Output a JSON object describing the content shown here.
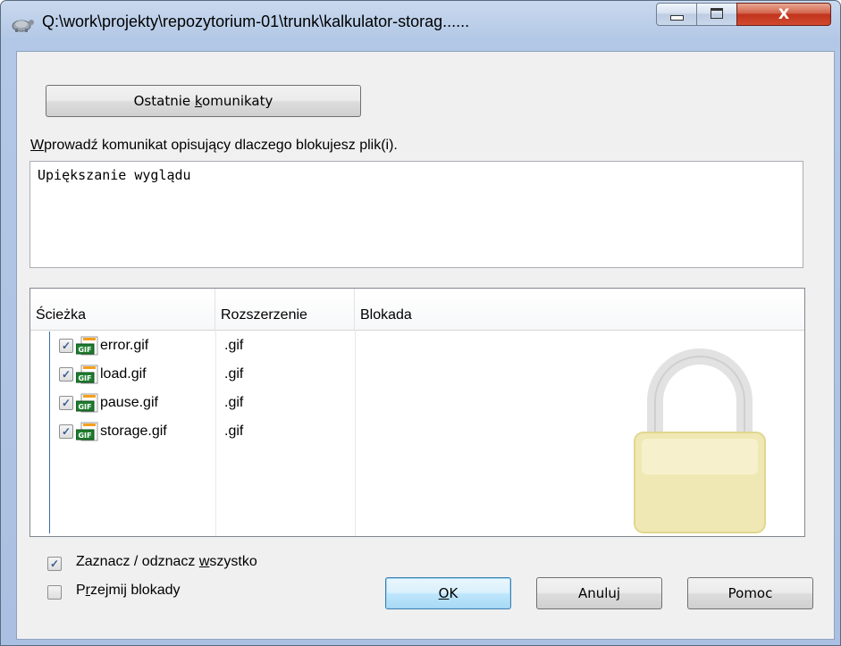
{
  "window": {
    "title": "Q:\\work\\projekty\\repozytorium-01\\trunk\\kalkulator-storag......",
    "close_glyph": "X"
  },
  "recent_messages_button": {
    "pre": "Ostatnie ",
    "accel": "k",
    "post": "omunikaty"
  },
  "message_label": {
    "accel": "W",
    "post": "prowadź komunikat opisujący dlaczego blokujesz plik(i)."
  },
  "message_value": "Upiększanie wyglądu",
  "file_list": {
    "columns": {
      "path": "Ścieżka",
      "extension": "Rozszerzenie",
      "lock": "Blokada"
    },
    "rows": [
      {
        "name": "error.gif",
        "ext": ".gif",
        "checked": true
      },
      {
        "name": "load.gif",
        "ext": ".gif",
        "checked": true
      },
      {
        "name": "pause.gif",
        "ext": ".gif",
        "checked": true
      },
      {
        "name": "storage.gif",
        "ext": ".gif",
        "checked": true
      }
    ],
    "icon": "gif-file-icon",
    "icon_text": "GIF",
    "watermark_icon": "padlock-icon"
  },
  "select_all": {
    "pre": "Zaznacz / odznacz ",
    "accel": "w",
    "post": "szystko",
    "checked": true
  },
  "steal_locks": {
    "pre": "P",
    "accel": "r",
    "post": "zejmij blokady",
    "checked": false
  },
  "buttons": {
    "ok": {
      "accel": "O",
      "post": "K"
    },
    "cancel": "Anuluj",
    "help": "Pomoc"
  },
  "check_glyph": "✓",
  "colors": {
    "title_close": "#c2331c",
    "ok_button_border": "#3c7fb1",
    "lock_body": "#ede6a9"
  }
}
